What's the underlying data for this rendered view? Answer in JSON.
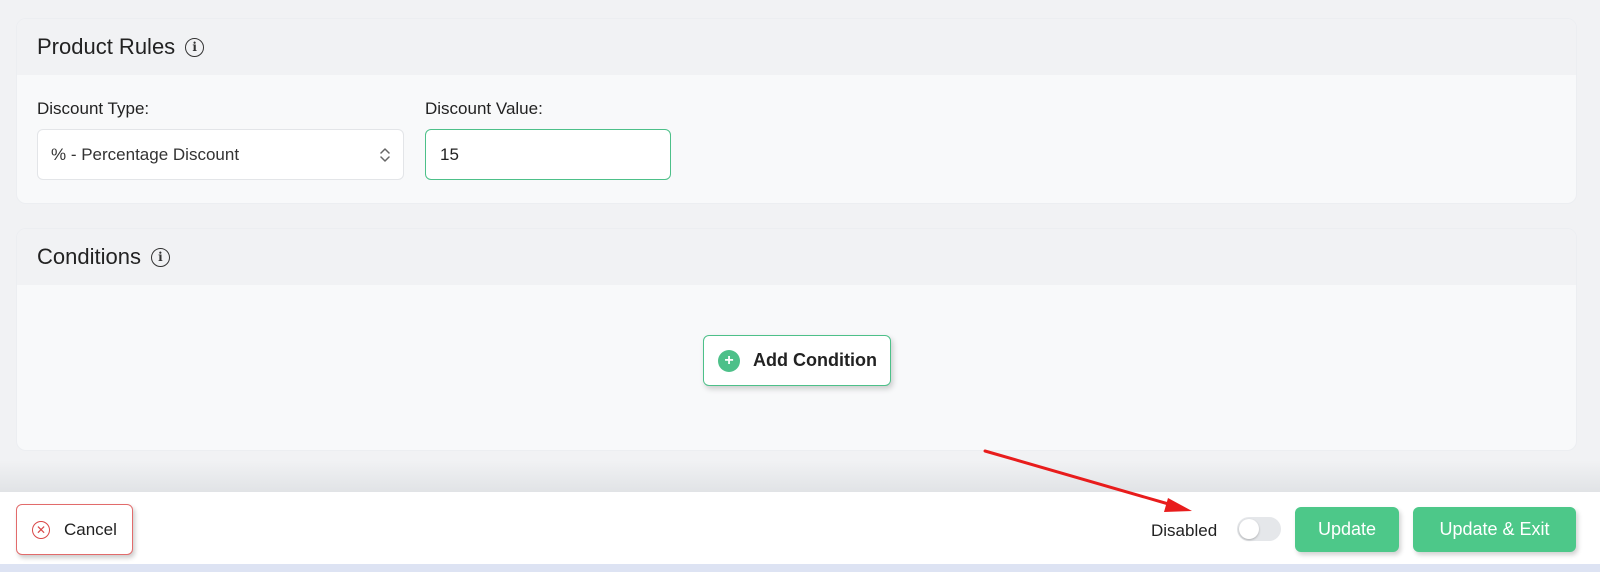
{
  "product_rules": {
    "title": "Product Rules",
    "info_icon": "info-icon",
    "discount_type_label": "Discount Type:",
    "discount_type_value": "% - Percentage Discount",
    "discount_value_label": "Discount Value:",
    "discount_value": "15"
  },
  "conditions": {
    "title": "Conditions",
    "info_icon": "info-icon",
    "add_condition_label": "Add Condition"
  },
  "footer": {
    "cancel_label": "Cancel",
    "status_label": "Disabled",
    "toggle_on": false,
    "update_label": "Update",
    "update_exit_label": "Update & Exit"
  },
  "colors": {
    "accent_green": "#4dc889",
    "cancel_red": "#d94848",
    "annotation_arrow": "#e81c1c"
  }
}
